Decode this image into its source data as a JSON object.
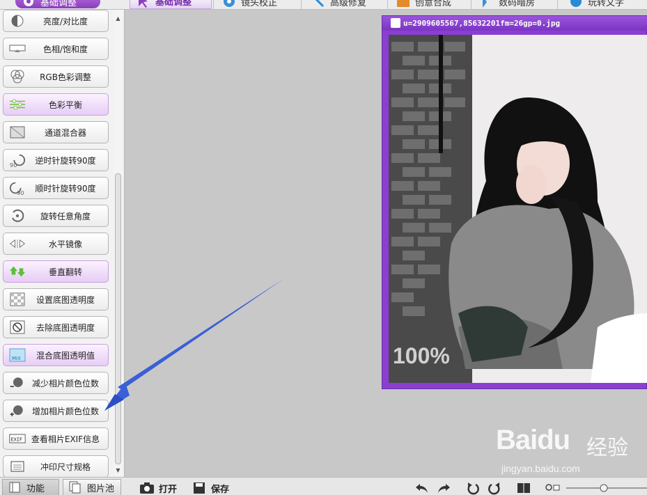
{
  "toolbar": {
    "tabs": [
      {
        "label": "基础调整"
      },
      {
        "label": "镜头校正"
      },
      {
        "label": "高级修复"
      },
      {
        "label": "创意合成"
      },
      {
        "label": "数码暗房"
      },
      {
        "label": "玩转文字"
      }
    ],
    "active_home": "基础调整",
    "accent": "#8b3fbd"
  },
  "functions": [
    {
      "label": "亮度/对比度",
      "icon": "brightness-icon",
      "highlighted": false
    },
    {
      "label": "色相/饱和度",
      "icon": "hue-icon",
      "highlighted": false
    },
    {
      "label": "RGB色彩调整",
      "icon": "rgb-icon",
      "highlighted": false
    },
    {
      "label": "色彩平衡",
      "icon": "color-balance-icon",
      "highlighted": true
    },
    {
      "label": "通道混合器",
      "icon": "channel-mixer-icon",
      "highlighted": false
    },
    {
      "label": "逆时针旋转90度",
      "icon": "rotate-ccw-icon",
      "highlighted": false
    },
    {
      "label": "顺时针旋转90度",
      "icon": "rotate-cw-icon",
      "highlighted": false
    },
    {
      "label": "旋转任意角度",
      "icon": "rotate-any-icon",
      "highlighted": false
    },
    {
      "label": "水平镜像",
      "icon": "mirror-icon",
      "highlighted": false
    },
    {
      "label": "垂直翻转",
      "icon": "flip-vertical-icon",
      "highlighted": true
    },
    {
      "label": "设置底图透明度",
      "icon": "transparency-icon",
      "highlighted": false
    },
    {
      "label": "去除底图透明度",
      "icon": "remove-transparency-icon",
      "highlighted": false
    },
    {
      "label": "混合底图透明值",
      "icon": "mix-icon",
      "highlighted": true
    },
    {
      "label": "减少相片颜色位数",
      "icon": "reduce-colors-icon",
      "highlighted": false
    },
    {
      "label": "增加相片颜色位数",
      "icon": "increase-colors-icon",
      "highlighted": false
    },
    {
      "label": "查看相片EXIF信息",
      "icon": "exif-icon",
      "highlighted": false
    },
    {
      "label": "冲印尺寸规格",
      "icon": "print-size-icon",
      "highlighted": false
    }
  ],
  "image_window": {
    "title": "u=2909605567,85632201fm=26gp=0.jpg",
    "zoom": "100%",
    "frame_color": "#8a3fd1"
  },
  "watermark": {
    "logo": "Baidu",
    "cn": "经验",
    "url": "jingyan.baidu.com"
  },
  "bottom": {
    "tab_functions": "功能",
    "tab_pool": "图片池",
    "open": "打开",
    "save": "保存"
  },
  "annotation": {
    "arrow_color": "#3a5fd6"
  }
}
